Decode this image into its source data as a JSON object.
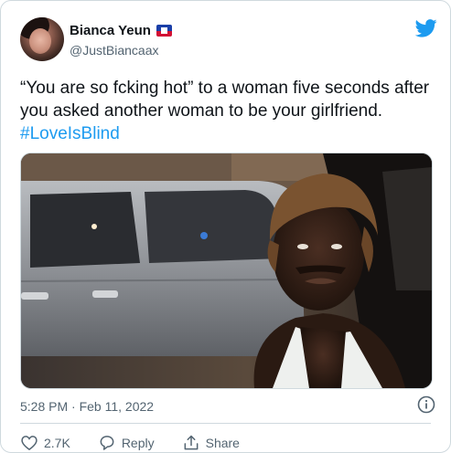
{
  "user": {
    "display_name": "Bianca Yeun",
    "handle": "@JustBiancaax",
    "flag_icon": "haiti-flag-icon"
  },
  "tweet": {
    "text_main": "“You are so fcking hot” to a woman five seconds after you asked another woman to be your girlfriend. ",
    "hashtag": "#LoveIsBlind",
    "timestamp": "5:28 PM · Feb 11, 2022"
  },
  "actions": {
    "likes_count": "2.7K",
    "reply_label": "Reply",
    "share_label": "Share"
  },
  "colors": {
    "accent": "#1d9bf0",
    "muted": "#536471",
    "text": "#0f1419",
    "border": "#cfd9de"
  },
  "icons": [
    "twitter-bird-icon",
    "info-icon",
    "heart-icon",
    "reply-icon",
    "share-icon"
  ]
}
